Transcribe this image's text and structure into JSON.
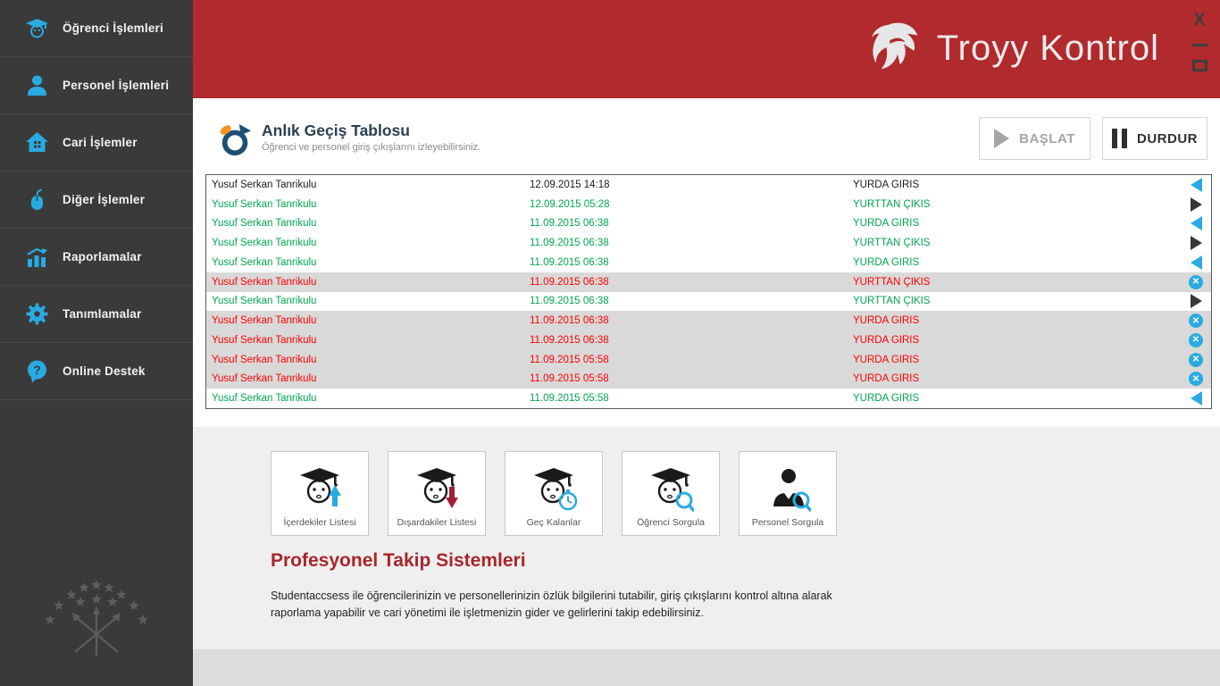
{
  "window": {
    "controls": {
      "close": "X",
      "minimize": "minimize",
      "maximize": "maximize"
    }
  },
  "brand": {
    "word1": "Troyy",
    "word2": "Kontrol"
  },
  "colors": {
    "header_red": "#b02a2e",
    "sidebar_dark": "#3a3a3a",
    "accent_blue": "#29abe2",
    "entry_green": "#00a651",
    "alert_red": "#ff0000",
    "row_gray": "#d9d9d9",
    "heading_red": "#a8262b"
  },
  "sidebar": {
    "items": [
      {
        "label": "Öğrenci İşlemleri",
        "icon": "student-icon"
      },
      {
        "label": "Personel İşlemleri",
        "icon": "person-icon"
      },
      {
        "label": "Cari İşlemler",
        "icon": "home-icon"
      },
      {
        "label": "Diğer İşlemler",
        "icon": "mouse-icon"
      },
      {
        "label": "Raporlamalar",
        "icon": "chart-icon"
      },
      {
        "label": "Tanımlamalar",
        "icon": "gear-icon"
      },
      {
        "label": "Online Destek",
        "icon": "help-bubble-icon"
      }
    ]
  },
  "main": {
    "title": "Anlık Geçiş Tablosu",
    "subtitle": "Öğrenci ve personel giriş çıkışlarını izleyebilirsiniz.",
    "start_button": "BAŞLAT",
    "stop_button": "DURDUR",
    "table": {
      "rows": [
        {
          "name": "Yusuf Serkan Tanrikulu",
          "datetime": "12.09.2015 14:18",
          "status": "YURDA GIRIS",
          "state": "black",
          "icon": "in"
        },
        {
          "name": "Yusuf Serkan Tanrikulu",
          "datetime": "12.09.2015 05:28",
          "status": "YURTTAN ÇIKIS",
          "state": "green",
          "icon": "out"
        },
        {
          "name": "Yusuf Serkan Tanrikulu",
          "datetime": "11.09.2015 06:38",
          "status": "YURDA GIRIS",
          "state": "green",
          "icon": "in"
        },
        {
          "name": "Yusuf Serkan Tanrikulu",
          "datetime": "11.09.2015 06:38",
          "status": "YURTTAN ÇIKIS",
          "state": "green",
          "icon": "out"
        },
        {
          "name": "Yusuf Serkan Tanrikulu",
          "datetime": "11.09.2015 06:38",
          "status": "YURDA GIRIS",
          "state": "green",
          "icon": "in"
        },
        {
          "name": "Yusuf Serkan Tanrikulu",
          "datetime": "11.09.2015 06:38",
          "status": "YURTTAN ÇIKIS",
          "state": "red",
          "icon": "cancel"
        },
        {
          "name": "Yusuf Serkan Tanrikulu",
          "datetime": "11.09.2015 06:38",
          "status": "YURTTAN ÇIKIS",
          "state": "green",
          "icon": "out"
        },
        {
          "name": "Yusuf Serkan Tanrikulu",
          "datetime": "11.09.2015 06:38",
          "status": "YURDA GIRIS",
          "state": "red",
          "icon": "cancel"
        },
        {
          "name": "Yusuf Serkan Tanrikulu",
          "datetime": "11.09.2015 06:38",
          "status": "YURDA GIRIS",
          "state": "red",
          "icon": "cancel"
        },
        {
          "name": "Yusuf Serkan Tanrikulu",
          "datetime": "11.09.2015 05:58",
          "status": "YURDA GIRIS",
          "state": "red",
          "icon": "cancel"
        },
        {
          "name": "Yusuf Serkan Tanrikulu",
          "datetime": "11.09.2015 05:58",
          "status": "YURDA GIRIS",
          "state": "red",
          "icon": "cancel"
        },
        {
          "name": "Yusuf Serkan Tanrikulu",
          "datetime": "11.09.2015 05:58",
          "status": "YURDA GIRIS",
          "state": "green",
          "icon": "in"
        }
      ]
    }
  },
  "shortcuts": [
    {
      "label": "İçerdekiler Listesi",
      "icon": "student-up-icon"
    },
    {
      "label": "Dışardakiler Listesi",
      "icon": "student-down-icon"
    },
    {
      "label": "Geç Kalanlar",
      "icon": "student-timer-icon"
    },
    {
      "label": "Öğrenci Sorgula",
      "icon": "student-search-icon"
    },
    {
      "label": "Personel Sorgula",
      "icon": "person-search-icon"
    }
  ],
  "promo": {
    "heading": "Profesyonel Takip Sistemleri",
    "body": "Studentaccsess ile öğrencilerinizin ve personellerinizin özlük bilgilerini tutabilir, giriş çıkışlarını kontrol altına alarak raporlama yapabilir ve cari yönetimi ile işletmenizin gider ve gelirlerini takip edebilirsiniz."
  }
}
